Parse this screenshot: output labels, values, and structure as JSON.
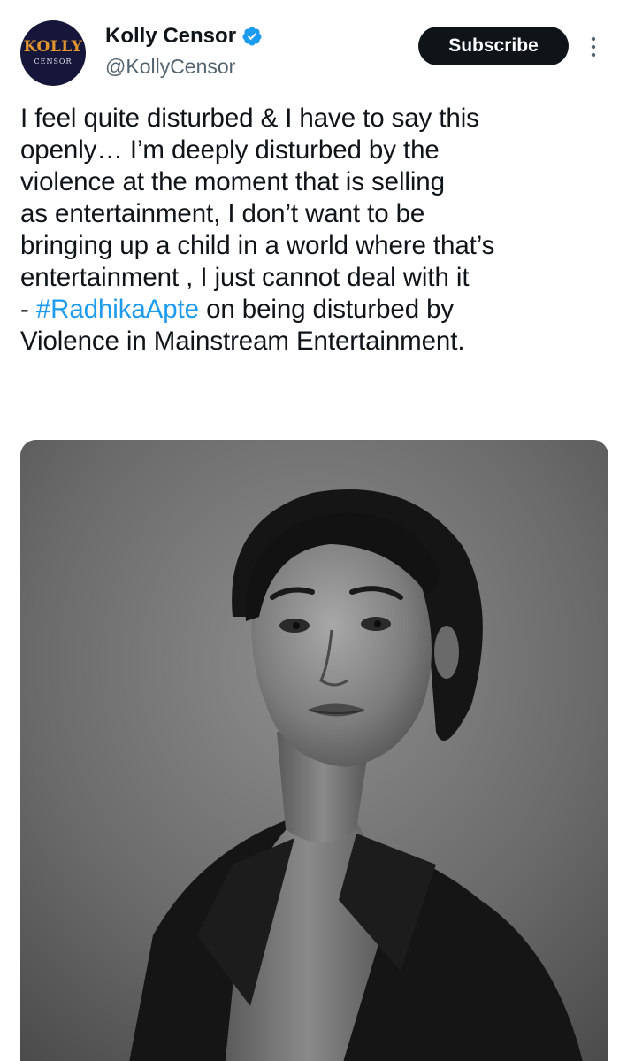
{
  "author": {
    "display_name": "Kolly Censor",
    "handle": "@KollyCensor",
    "avatar_text_main": "KOLLY",
    "avatar_text_sub": "CENSOR",
    "verified": true
  },
  "actions": {
    "subscribe_label": "Subscribe",
    "more_icon": "more-vertical-icon"
  },
  "tweet": {
    "lines": [
      "I feel quite disturbed & I have to say this",
      "openly… I’m deeply disturbed by the",
      "violence at the moment that is selling",
      "as entertainment, I don’t want to be",
      "bringing up a child in a world where that’s",
      "entertainment , I just cannot deal with it"
    ],
    "line7_prefix": "- ",
    "hashtag": "#RadhikaApte",
    "line7_suffix": " on being disturbed by",
    "line8": "Violence in Mainstream Entertainment."
  },
  "media": {
    "type": "photo",
    "description_icon": "portrait-photo"
  },
  "colors": {
    "text": "#0f1419",
    "secondary": "#536471",
    "link": "#1d9bf0",
    "verified": "#1d9bf0",
    "button_bg": "#0f1419"
  }
}
